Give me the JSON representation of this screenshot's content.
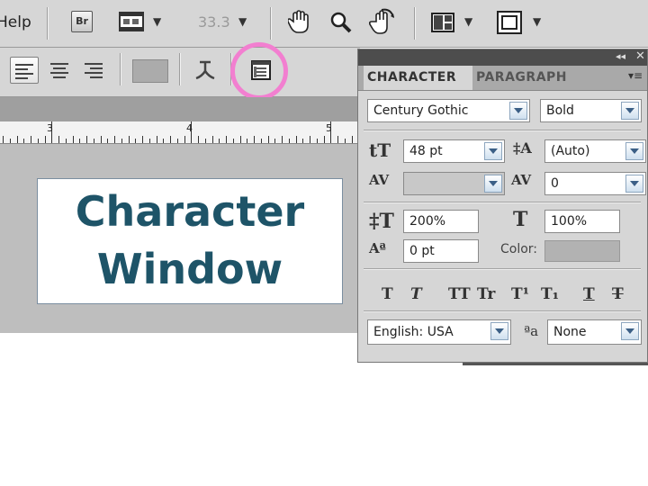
{
  "appbar": {
    "help_label": "Help",
    "bridge_label": "Br",
    "zoom_value": "33.3",
    "icons": [
      "bridge-icon",
      "film-icon",
      "zoom-dropdown",
      "hand-icon",
      "zoom-icon",
      "rotate-view-icon",
      "arrange-documents-icon",
      "screen-mode-icon"
    ]
  },
  "options": {
    "alignment": [
      "align-left",
      "align-center",
      "align-right"
    ],
    "active_alignment": "align-left",
    "text_color": "#ababab",
    "highlight_color": "#f27fd0"
  },
  "ruler": {
    "labels": [
      "3",
      "4",
      "5"
    ]
  },
  "canvas_text": {
    "line1": "Character",
    "line2": "Window",
    "color": "#1e5468"
  },
  "panel": {
    "tabs": [
      "CHARACTER",
      "PARAGRAPH"
    ],
    "font_family": "Century Gothic",
    "font_style": "Bold",
    "font_size": "48 pt",
    "leading": "(Auto)",
    "kerning": "",
    "tracking": "0",
    "vertical_scale": "200%",
    "horizontal_scale": "100%",
    "baseline_shift": "0 pt",
    "color_label": "Color:",
    "color_value": "#b2b2b2",
    "styles": [
      "T",
      "T",
      "TT",
      "Tr",
      "T¹",
      "T₁",
      "T",
      "T"
    ],
    "language": "English: USA",
    "antialias": "None"
  }
}
